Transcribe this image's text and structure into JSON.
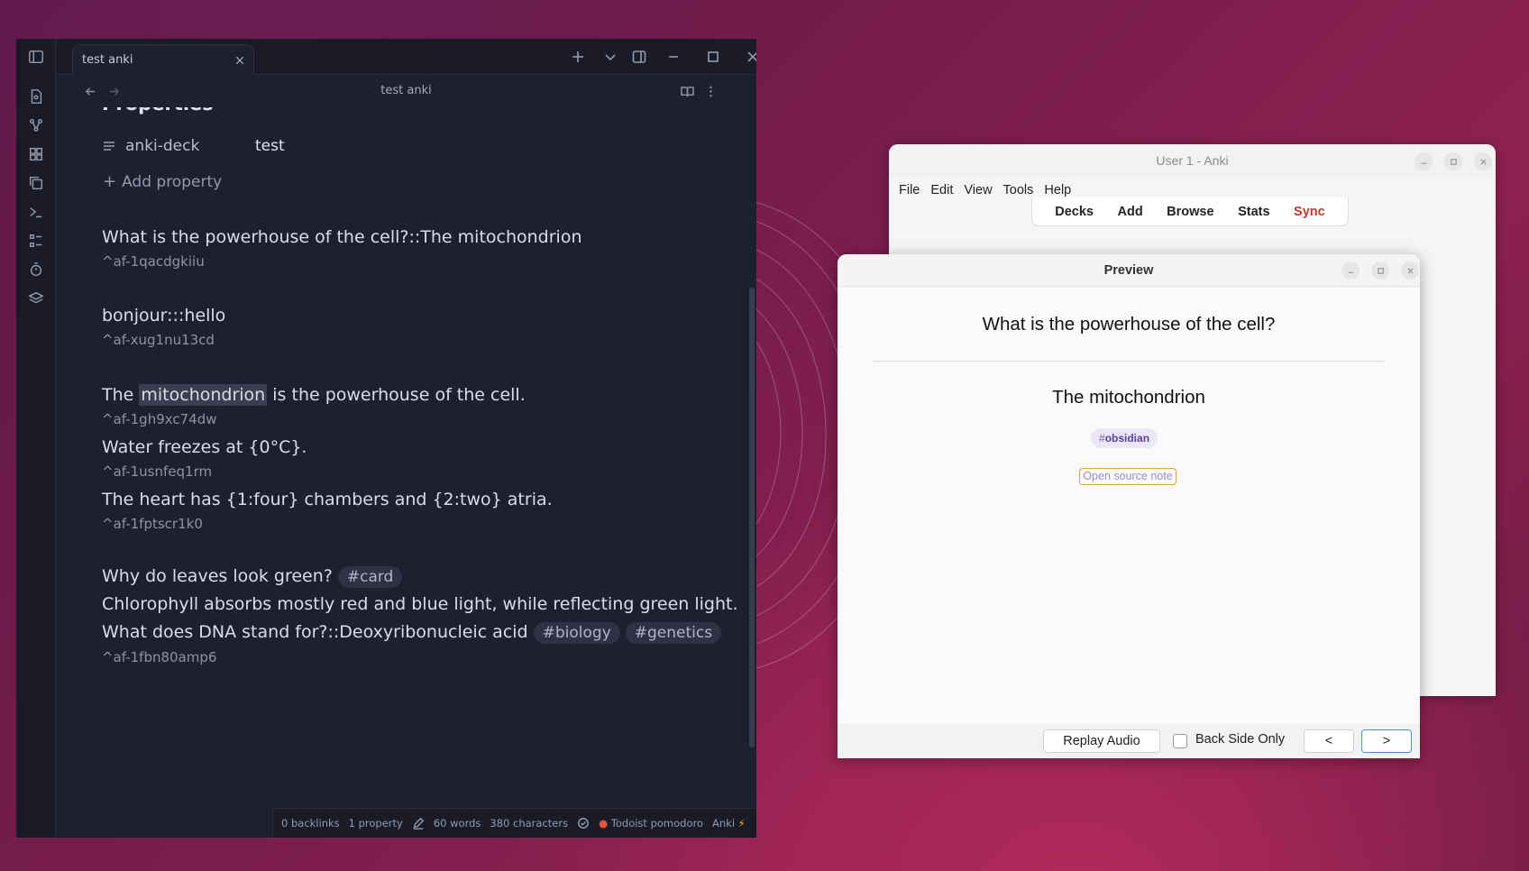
{
  "obsidian": {
    "tab_title": "test anki",
    "nav_title": "test anki",
    "properties_heading": "Properties",
    "property": {
      "key": "anki-deck",
      "value": "test"
    },
    "add_property": "Add property",
    "blocks": {
      "b1": {
        "text": "What is the powerhouse of the cell?::The mitochondrion",
        "id": "^af-1qacdgkiiu"
      },
      "b2": {
        "text": "bonjour:::hello",
        "id": "^af-xug1nu13cd"
      },
      "b3": {
        "before": "The ",
        "highlight": "mitochondrion",
        "after": " is the powerhouse of the cell.",
        "id": "^af-1gh9xc74dw"
      },
      "b4": {
        "text": "Water freezes at {0°C}.",
        "id": "^af-1usnfeq1rm"
      },
      "b5": {
        "text": "The heart has {1:four} chambers and {2:two} atria.",
        "id": "^af-1fptscr1k0"
      },
      "b6": {
        "question": "Why do leaves look green?",
        "tag": "#card",
        "answer": "Chlorophyll absorbs mostly red and blue light, while reflecting green light."
      },
      "b7": {
        "text": "What does DNA stand for?::Deoxyribonucleic acid",
        "tags": [
          "#biology",
          "#genetics"
        ],
        "id": "^af-1fbn80amp6"
      }
    },
    "status": {
      "backlinks": "0 backlinks",
      "properties": "1 property",
      "words": "60 words",
      "characters": "380 characters",
      "pomodoro": "Todoist pomodoro",
      "anki": "Anki"
    }
  },
  "anki": {
    "title": "User 1 - Anki",
    "menu": [
      "File",
      "Edit",
      "View",
      "Tools",
      "Help"
    ],
    "toolbar": [
      "Decks",
      "Add",
      "Browse",
      "Stats",
      "Sync"
    ]
  },
  "preview": {
    "title": "Preview",
    "question": "What is the powerhouse of the cell?",
    "answer": "The mitochondrion",
    "tag_hash": "#",
    "tag": "obsidian",
    "link": "Open source note",
    "replay": "Replay Audio",
    "back_only": "Back Side Only",
    "prev": "<",
    "next": ">"
  },
  "colors": {
    "obsidian_bg": "#1e2030",
    "anki_sync": "#c0392b",
    "preview_tag": "#5b3ea0",
    "link_border": "#e2a23a"
  }
}
